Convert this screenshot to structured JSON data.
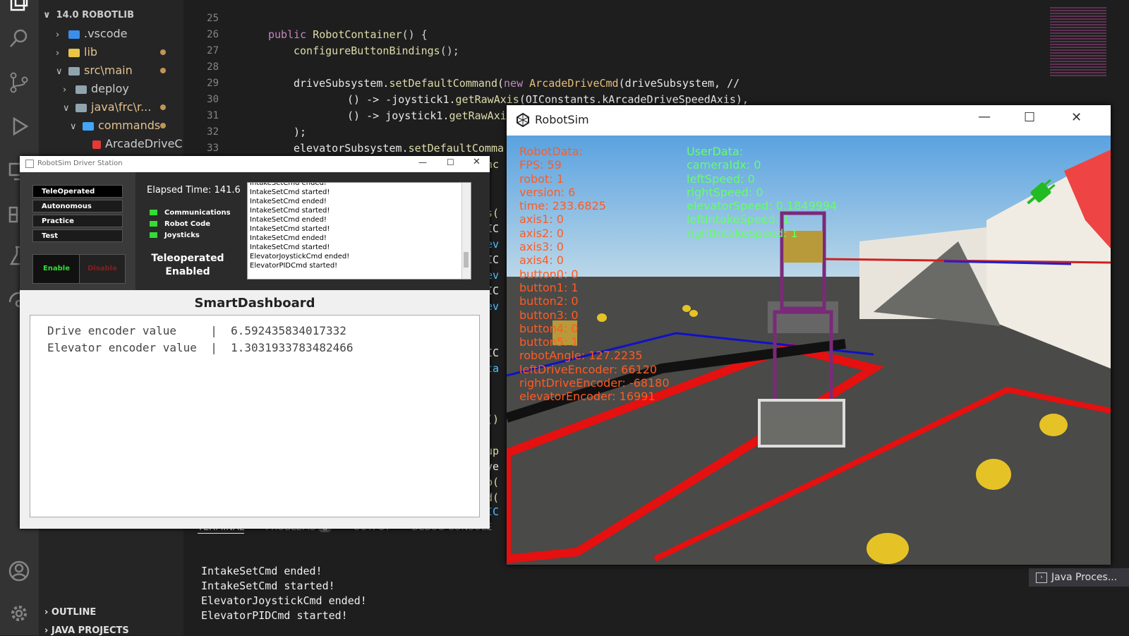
{
  "explorer": {
    "root": "14.0 ROBOTLIB",
    "items": [
      ".vscode",
      "lib",
      "src\\main",
      "deploy",
      "java\\frc\\r...",
      "commands",
      "ArcadeDriveC..."
    ],
    "outline": "OUTLINE",
    "java_projects": "JAVA PROJECTS"
  },
  "editor": {
    "lines": [
      {
        "n": "25"
      },
      {
        "n": "26",
        "kw": "public ",
        "fn": "RobotContainer",
        "rest": "() {"
      },
      {
        "n": "27",
        "fn": "configureButtonBindings",
        "rest": "();"
      },
      {
        "n": "28"
      },
      {
        "n": "29",
        "rest": "driveSubsystem.",
        "fn": "setDefaultCommand",
        "rest2": "(",
        "kw": "new ",
        "ty": "ArcadeDriveCmd",
        "rest3": "(driveSubsystem, //"
      },
      {
        "n": "30",
        "rest": "() -> -joystick1.",
        "fn": "getRawAxis",
        "rest2": "(OIConstants.kArcadeDriveSpeedAxis),"
      },
      {
        "n": "31",
        "rest": "() -> joystick1.",
        "fn": "getRawAxi"
      },
      {
        "n": "32",
        "rest": ");"
      },
      {
        "n": "33",
        "rest": "elevatorSubsystem.",
        "fn": "setDefaultComma"
      }
    ],
    "fragments": [
      "anc",
      "gs(",
      "OIC",
      "lev",
      "OIC",
      "lev",
      "OIC",
      "lev",
      "OIC",
      "nta",
      "d()",
      "oup",
      "ive",
      "up(",
      "md(",
      "OIC"
    ]
  },
  "panel": {
    "tabs": [
      "TERMINAL",
      "PROBLEMS",
      "OUTPUT",
      "DEBUG CONSOLE"
    ],
    "problems_count": "8",
    "terminal": [
      "IntakeSetCmd ended!",
      "IntakeSetCmd started!",
      "ElevatorJoystickCmd ended!",
      "ElevatorPIDCmd started!"
    ],
    "java_process": "Java Proces..."
  },
  "driver_station": {
    "title": "RobotSim Driver Station",
    "modes": [
      "TeleOperated",
      "Autonomous",
      "Practice",
      "Test"
    ],
    "enable": "Enable",
    "disable": "Disable",
    "elapsed": "Elapsed Time: 141.6",
    "indicators": [
      "Communications",
      "Robot Code",
      "Joysticks"
    ],
    "state_line1": "Teleoperated",
    "state_line2": "Enabled",
    "log": [
      "IntakeSetCmd ended!",
      "IntakeSetCmd started!",
      "IntakeSetCmd ended!",
      "IntakeSetCmd started!",
      "IntakeSetCmd ended!",
      "IntakeSetCmd started!",
      "IntakeSetCmd ended!",
      "IntakeSetCmd started!",
      "ElevatorJoystickCmd ended!",
      "ElevatorPIDCmd started!"
    ]
  },
  "smartdashboard": {
    "title": "SmartDashboard",
    "rows": [
      {
        "label": "Drive encoder value   ",
        "sep": "|",
        "value": "6.592435834017332"
      },
      {
        "label": "Elevator encoder value",
        "sep": "|",
        "value": "1.3031933783482466"
      }
    ]
  },
  "robotsim": {
    "title": "RobotSim",
    "robot_data": [
      "RobotData:",
      "FPS: 59",
      "robot: 1",
      "version: 6",
      "time: 233.6825",
      "axis1: 0",
      "axis2: 0",
      "axis3: 0",
      "axis4: 0",
      "button0: 0",
      "button1: 1",
      "button2: 0",
      "button3: 0",
      "button4: 0",
      "button5: 1",
      "robotAngle: 127.2235",
      "leftDriveEncoder: 66120",
      "rightDriveEncoder: -68180",
      "elevatorEncoder: 16991"
    ],
    "user_data": [
      "UserData:",
      "cameraIdx: 0",
      "leftSpeed: 0",
      "rightSpeed: 0",
      "elevatorSpeed: 0.1849994",
      "leftIntakeSpeed: 1",
      "rightIntakeSpeed: 1"
    ],
    "colors": {
      "robot_text": "#ff5b22",
      "user_text": "#66ff66",
      "sky": "#79b6e8",
      "floor": "#4a4a48"
    }
  }
}
